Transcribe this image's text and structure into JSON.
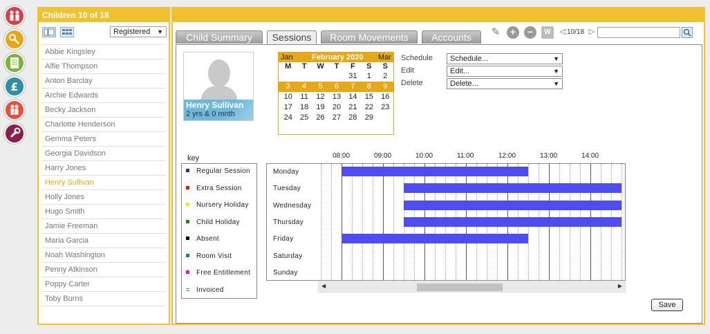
{
  "rail": [
    {
      "name": "family-icon",
      "color": "#d6414a"
    },
    {
      "name": "rattle-icon",
      "color": "#e6a817"
    },
    {
      "name": "register-icon",
      "color": "#7ab531"
    },
    {
      "name": "pound-icon",
      "color": "#2d8fa4"
    },
    {
      "name": "staff-icon",
      "color": "#e94f3a"
    },
    {
      "name": "wrench-icon",
      "color": "#8a1f4c"
    }
  ],
  "children": {
    "title": "Children 10 of 18",
    "filter_value": "Registered",
    "list": [
      "Abbie Kingsley",
      "Alfie Thompson",
      "Anton Barclay",
      "Archie Edwards",
      "Becky Jackson",
      "Charlotte Henderson",
      "Gemma Peters",
      "Georgia Davidson",
      "Harry Jones",
      "Henry Sullivan",
      "Holly Jones",
      "Hugo Smith",
      "Jamie Freeman",
      "Maria Garcia",
      "Noah Washington",
      "Penny Atkinson",
      "Poppy Carter",
      "Toby Burns"
    ],
    "selected": "Henry Sullivan"
  },
  "tabs": [
    "Child Summary",
    "Sessions",
    "Room Movements",
    "Accounts"
  ],
  "active_tab": "Sessions",
  "pager": "10/18",
  "search": {
    "value": ""
  },
  "child": {
    "name": "Henry Sullivan",
    "age": "2 yrs & 0 mnth"
  },
  "calendar": {
    "prev": "Jan",
    "current": "February 2020",
    "next": "Mar",
    "weekdays": [
      "M",
      "T",
      "W",
      "T",
      "F",
      "S",
      "S"
    ],
    "weeks": [
      [
        "",
        "",
        "",
        "",
        "31",
        "1",
        "2"
      ],
      [
        "3",
        "4",
        "5",
        "6",
        "7",
        "8",
        "9"
      ],
      [
        "10",
        "11",
        "12",
        "13",
        "14",
        "15",
        "16"
      ],
      [
        "17",
        "18",
        "19",
        "20",
        "21",
        "22",
        "23"
      ],
      [
        "24",
        "25",
        "26",
        "27",
        "28",
        "29",
        ""
      ]
    ],
    "highlight_week": 1
  },
  "actions": [
    {
      "label": "Schedule",
      "value": "Schedule..."
    },
    {
      "label": "Edit",
      "value": "Edit..."
    },
    {
      "label": "Delete",
      "value": "Delete..."
    }
  ],
  "key": {
    "title": "key",
    "items": [
      {
        "label": "Regular Session",
        "color": "#2b2bb0"
      },
      {
        "label": "Extra Session",
        "color": "#ee1111"
      },
      {
        "label": "Nursery Holiday",
        "color": "#f0e814"
      },
      {
        "label": "Child Holiday",
        "color": "#118a11"
      },
      {
        "label": "Absent",
        "color": "#000000"
      },
      {
        "label": "Room Visit",
        "color": "#118a7a"
      },
      {
        "label": "Free Entitlement",
        "color": "#ee11aa"
      },
      {
        "label": "Invoiced",
        "color": "#2d8fa4"
      }
    ]
  },
  "schedule": {
    "times": [
      "08:00",
      "09:00",
      "10:00",
      "11:00",
      "12:00",
      "13:00",
      "14:00"
    ],
    "days": [
      "Monday",
      "Tuesday",
      "Wednesday",
      "Thursday",
      "Friday",
      "Saturday",
      "Sunday"
    ],
    "sessions": [
      {
        "day": "Monday",
        "start": "08:00",
        "end": "12:30"
      },
      {
        "day": "Tuesday",
        "start": "09:30",
        "end": "14:45"
      },
      {
        "day": "Wednesday",
        "start": "09:30",
        "end": "14:45"
      },
      {
        "day": "Thursday",
        "start": "09:30",
        "end": "14:45"
      },
      {
        "day": "Friday",
        "start": "08:00",
        "end": "12:30"
      }
    ],
    "bar_color": "#4d4df2"
  },
  "save_label": "Save"
}
